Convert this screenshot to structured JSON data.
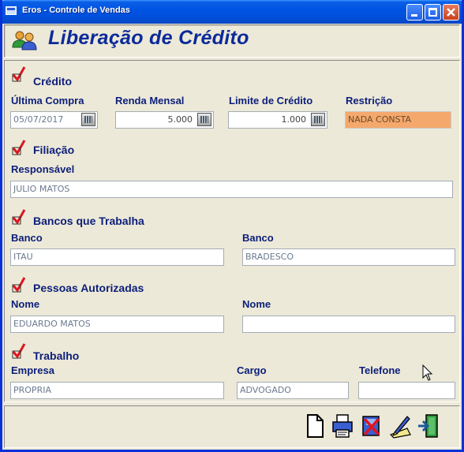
{
  "window": {
    "title": "Eros - Controle de Vendas",
    "buttons": [
      "minimize",
      "maximize",
      "close"
    ]
  },
  "header": {
    "title": "Liberação de Crédito",
    "icon": "people-icon"
  },
  "sections": {
    "credito": {
      "title": "Crédito",
      "ultima_compra_label": "Última Compra",
      "ultima_compra_value": "05/07/2017",
      "renda_mensal_label": "Renda Mensal",
      "renda_mensal_value": "5.000",
      "limite_credito_label": "Limite de Crédito",
      "limite_credito_value": "1.000",
      "restricao_label": "Restrição",
      "restricao_value": "NADA CONSTA"
    },
    "filiacao": {
      "title": "Filiação",
      "responsavel_label": "Responsável",
      "responsavel_value": "JULIO MATOS"
    },
    "bancos": {
      "title": "Bancos que Trabalha",
      "banco1_label": "Banco",
      "banco1_value": "ITAU",
      "banco2_label": "Banco",
      "banco2_value": "BRADESCO"
    },
    "pessoas": {
      "title": "Pessoas Autorizadas",
      "nome1_label": "Nome",
      "nome1_value": "EDUARDO MATOS",
      "nome2_label": "Nome",
      "nome2_value": ""
    },
    "trabalho": {
      "title": "Trabalho",
      "empresa_label": "Empresa",
      "empresa_value": "PROPRIA",
      "cargo_label": "Cargo",
      "cargo_value": "ADVOGADO",
      "telefone_label": "Telefone",
      "telefone_value": "(   )     -"
    }
  },
  "toolbar": {
    "buttons": [
      "new-document-icon",
      "print-icon",
      "delete-icon",
      "edit-icon",
      "exit-icon"
    ]
  },
  "colors": {
    "title_blue": "#0c2a9a",
    "label_blue": "#0c1e7a",
    "restriction_bg": "#f5a86c",
    "check_red": "#e0141e",
    "window_bg": "#ece9d8"
  }
}
